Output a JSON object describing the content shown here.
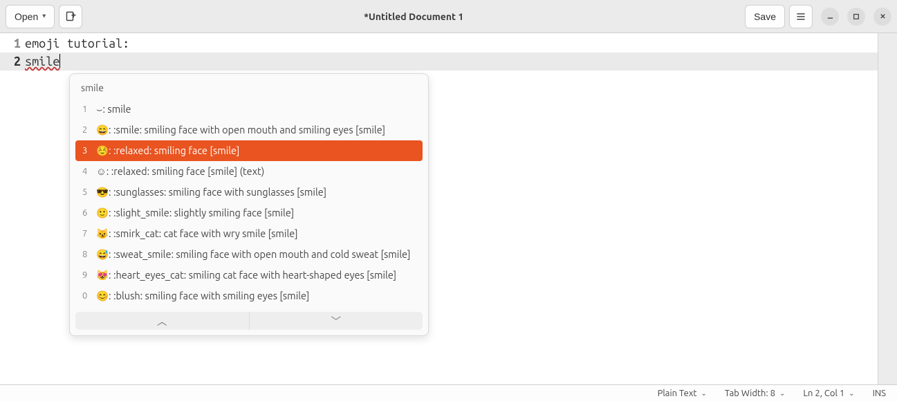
{
  "header": {
    "open_label": "Open",
    "title": "*Untitled Document 1",
    "save_label": "Save"
  },
  "editor": {
    "lines": [
      {
        "num": "1",
        "text": "emoji tutorial:",
        "current": false
      },
      {
        "num": "2",
        "text": "smile",
        "current": true,
        "wavy": true
      }
    ]
  },
  "popup": {
    "query": "smile",
    "selected_index": 2,
    "items": [
      {
        "num": "1",
        "text": "⌣: smile"
      },
      {
        "num": "2",
        "text": "😄: :smile: smiling face with open mouth and smiling eyes [smile]"
      },
      {
        "num": "3",
        "text": "☺️: :relaxed: smiling face [smile]"
      },
      {
        "num": "4",
        "text": "☺: :relaxed: smiling face [smile] (text)"
      },
      {
        "num": "5",
        "text": "😎: :sunglasses: smiling face with sunglasses [smile]"
      },
      {
        "num": "6",
        "text": "🙂: :slight_smile: slightly smiling face [smile]"
      },
      {
        "num": "7",
        "text": "😼: :smirk_cat: cat face with wry smile [smile]"
      },
      {
        "num": "8",
        "text": "😅: :sweat_smile: smiling face with open mouth and cold sweat [smile]"
      },
      {
        "num": "9",
        "text": "😻: :heart_eyes_cat: smiling cat face with heart-shaped eyes [smile]"
      },
      {
        "num": "0",
        "text": "😊: :blush: smiling face with smiling eyes [smile]"
      }
    ]
  },
  "statusbar": {
    "syntax": "Plain Text",
    "tabwidth": "Tab Width: 8",
    "position": "Ln 2, Col 1",
    "insert_mode": "INS"
  }
}
